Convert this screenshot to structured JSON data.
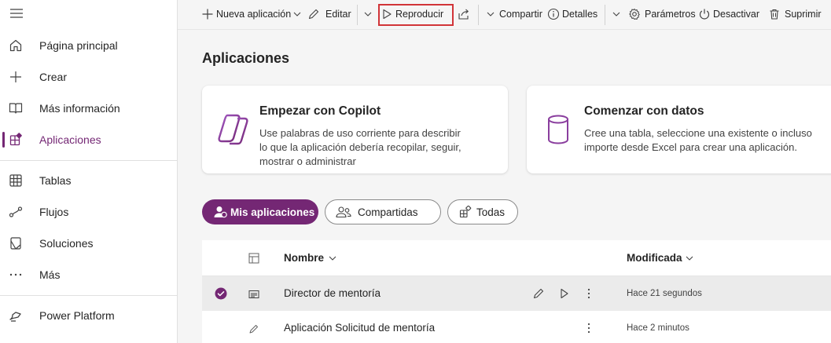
{
  "sidebar": {
    "items": [
      {
        "label": "Página principal",
        "icon": "home-icon"
      },
      {
        "label": "Crear",
        "icon": "plus-icon"
      },
      {
        "label": "Más información",
        "icon": "book-icon"
      },
      {
        "label": "Aplicaciones",
        "icon": "apps-icon",
        "active": true
      },
      {
        "label": "Tablas",
        "icon": "table-icon"
      },
      {
        "label": "Flujos",
        "icon": "flow-icon"
      },
      {
        "label": "Soluciones",
        "icon": "solutions-icon"
      },
      {
        "label": "Más",
        "icon": "more-icon"
      },
      {
        "label": "Power Platform",
        "icon": "power-platform-icon"
      }
    ]
  },
  "toolbar": {
    "new_app": "Nueva aplicación",
    "edit": "Editar",
    "play": "Reproducir",
    "share": "Compartir",
    "details": "Detalles",
    "settings": "Parámetros",
    "deactivate": "Desactivar",
    "delete": "Suprimir"
  },
  "main": {
    "title": "Aplicaciones",
    "cards": [
      {
        "title": "Empezar con Copilot",
        "desc_lines": [
          "Use palabras de uso corriente para describir",
          "lo que la aplicación debería recopilar, seguir,",
          "mostrar o administrar"
        ]
      },
      {
        "title": "Comenzar con datos",
        "desc_lines": [
          "Cree una tabla, seleccione una existente o incluso",
          "importe desde Excel para crear una aplicación."
        ]
      }
    ],
    "filters": [
      "Mis aplicaciones",
      "Compartidas",
      "Todas"
    ],
    "table": {
      "columns": {
        "name": "Nombre",
        "modified": "Modificada"
      },
      "rows": [
        {
          "name": "Director de mentoría",
          "modified": "Hace 21 segundos"
        },
        {
          "name": "Aplicación Solicitud de mentoría",
          "modified": "Hace 2 minutos"
        }
      ]
    }
  },
  "colors": {
    "accent": "#742774",
    "highlight": "#d13438"
  }
}
